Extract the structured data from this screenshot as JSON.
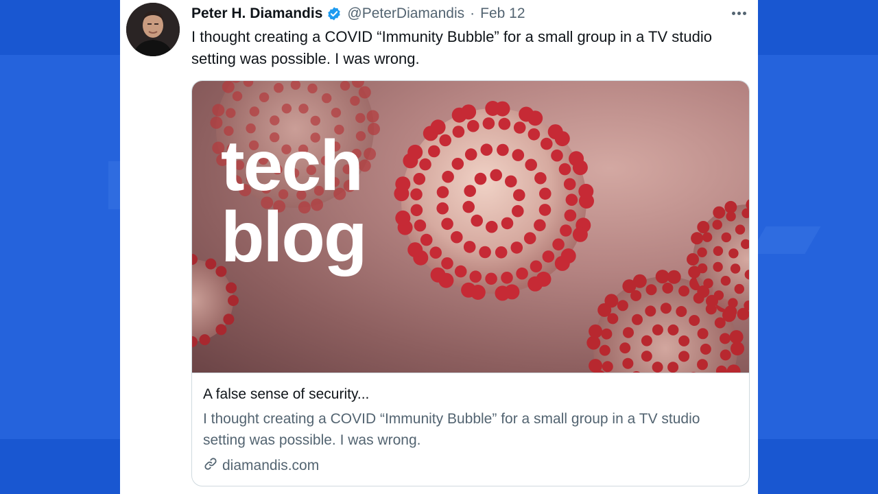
{
  "tweet": {
    "author_name": "Peter H. Diamandis",
    "handle": "@PeterDiamandis",
    "separator": "·",
    "date": "Feb 12",
    "text": "I thought creating a COVID “Immunity Bubble” for a small group in a TV studio setting was possible. I was wrong."
  },
  "icons": {
    "verified": "verified-badge-icon",
    "more": "more-options-icon",
    "link": "link-icon"
  },
  "link_card": {
    "image_logo_line1": "tech",
    "image_logo_line2": "blog",
    "title": "A false sense of security...",
    "description": "I thought creating a COVID “Immunity Bubble” for a small group in a TV studio setting was possible. I was wrong.",
    "domain": "diamandis.com"
  },
  "colors": {
    "background_blue": "#1957d1",
    "verified_blue": "#1d9bf0",
    "text_primary": "#0f1419",
    "text_secondary": "#536471"
  }
}
